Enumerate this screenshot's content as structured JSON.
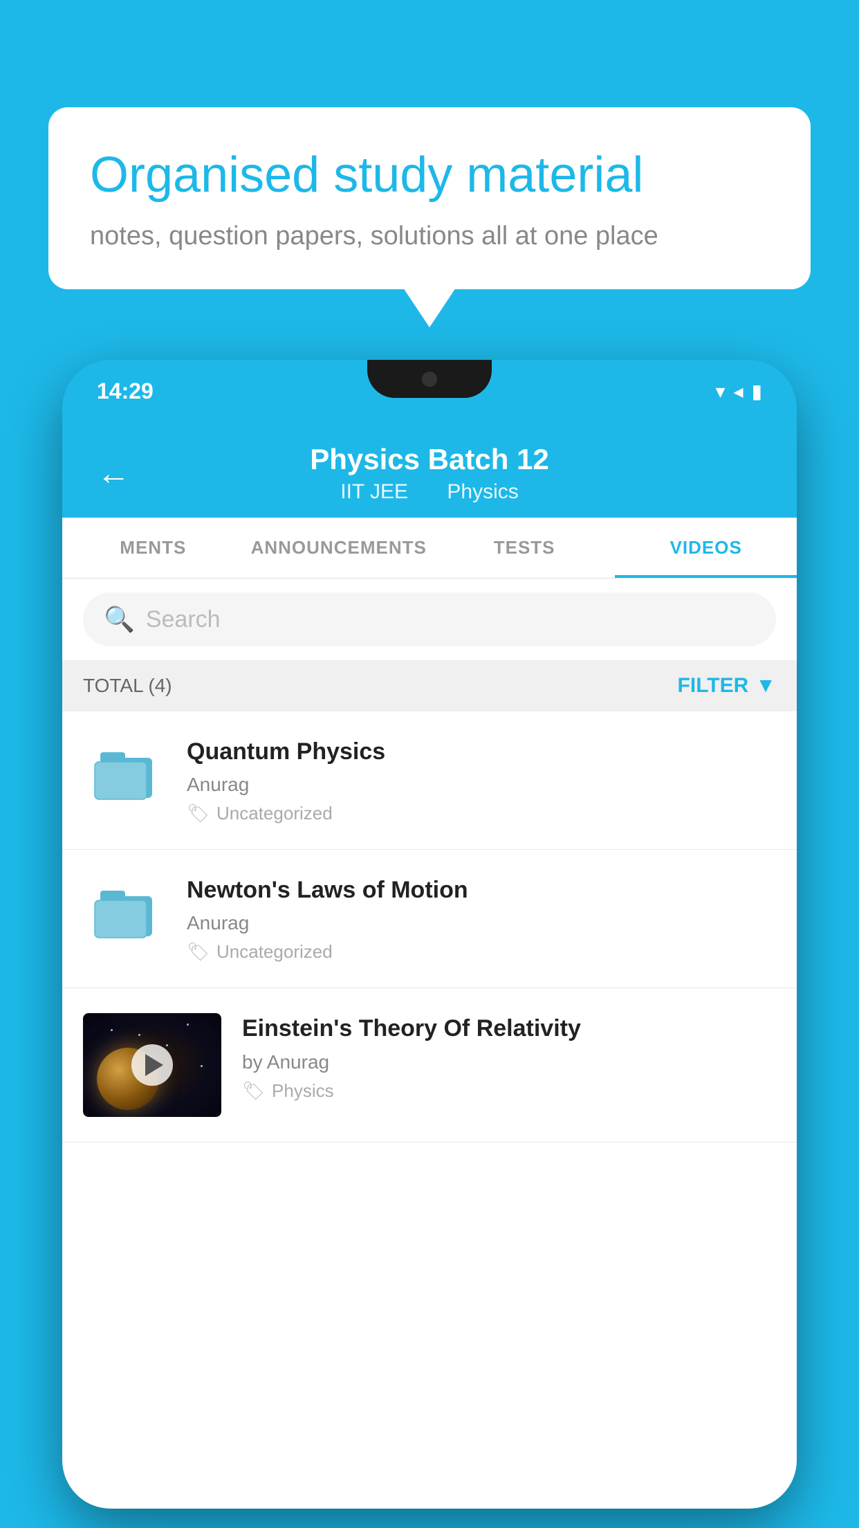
{
  "background_color": "#1DB8E8",
  "speech_bubble": {
    "title": "Organised study material",
    "subtitle": "notes, question papers, solutions all at one place"
  },
  "phone": {
    "status_bar": {
      "time": "14:29"
    },
    "header": {
      "back_label": "←",
      "title": "Physics Batch 12",
      "subtitle_part1": "IIT JEE",
      "subtitle_part2": "Physics"
    },
    "tabs": [
      {
        "label": "MENTS",
        "active": false
      },
      {
        "label": "ANNOUNCEMENTS",
        "active": false
      },
      {
        "label": "TESTS",
        "active": false
      },
      {
        "label": "VIDEOS",
        "active": true
      }
    ],
    "search": {
      "placeholder": "Search"
    },
    "filter_bar": {
      "total_label": "TOTAL (4)",
      "filter_label": "FILTER"
    },
    "videos": [
      {
        "id": "quantum-physics",
        "title": "Quantum Physics",
        "author": "Anurag",
        "category": "Uncategorized",
        "type": "folder",
        "has_thumbnail": false
      },
      {
        "id": "newtons-laws",
        "title": "Newton's Laws of Motion",
        "author": "Anurag",
        "category": "Uncategorized",
        "type": "folder",
        "has_thumbnail": false
      },
      {
        "id": "einsteins-theory",
        "title": "Einstein's Theory Of Relativity",
        "author": "by Anurag",
        "category": "Physics",
        "type": "video",
        "has_thumbnail": true
      }
    ]
  }
}
